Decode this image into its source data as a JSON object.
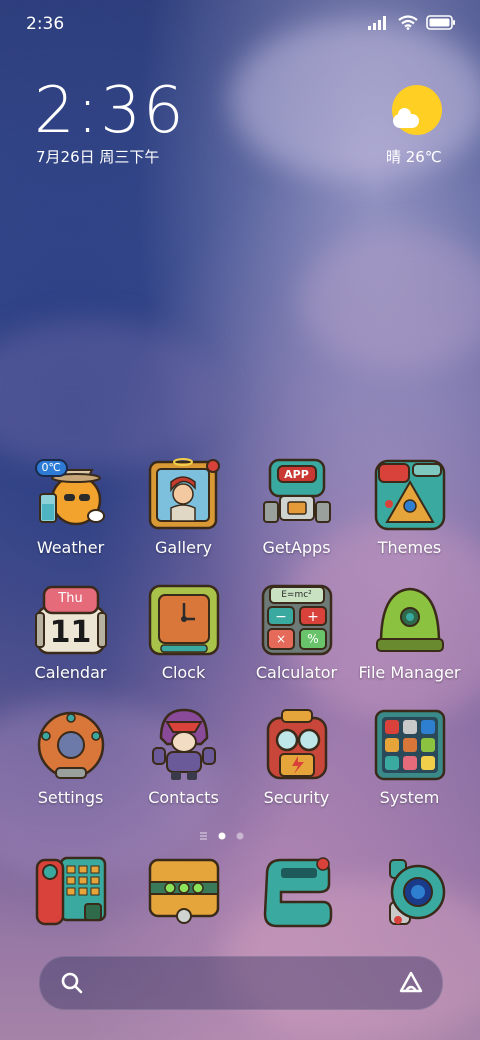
{
  "status_bar": {
    "time": "2:36"
  },
  "clock_widget": {
    "time": "2:36",
    "date": "7月26日 周三下午"
  },
  "weather_widget": {
    "text": "晴 26℃",
    "icon": "sunny-partly-cloudy-icon"
  },
  "apps": [
    {
      "label": "Weather",
      "icon": "weather-icon",
      "badge": "0℃"
    },
    {
      "label": "Gallery",
      "icon": "gallery-icon"
    },
    {
      "label": "GetApps",
      "icon": "getapps-icon",
      "badge": "APP"
    },
    {
      "label": "Themes",
      "icon": "themes-icon"
    },
    {
      "label": "Calendar",
      "icon": "calendar-icon",
      "day_name": "Thu",
      "day_number": "11"
    },
    {
      "label": "Clock",
      "icon": "clock-icon"
    },
    {
      "label": "Calculator",
      "icon": "calculator-icon",
      "screen_text": "E=mc²"
    },
    {
      "label": "File Manager",
      "icon": "file-manager-icon"
    },
    {
      "label": "Settings",
      "icon": "settings-icon"
    },
    {
      "label": "Contacts",
      "icon": "contacts-icon"
    },
    {
      "label": "Security",
      "icon": "security-icon"
    },
    {
      "label": "System",
      "icon": "system-folder-icon"
    }
  ],
  "dock": [
    {
      "icon": "phone-icon"
    },
    {
      "icon": "messages-icon"
    },
    {
      "icon": "browser-icon"
    },
    {
      "icon": "camera-icon"
    }
  ],
  "page_indicator": {
    "pages": 2,
    "current": 1
  },
  "colors": {
    "sun": "#ffcf24",
    "teal": "#3aa9a0",
    "orange": "#e58a2a",
    "red": "#d9423a"
  }
}
